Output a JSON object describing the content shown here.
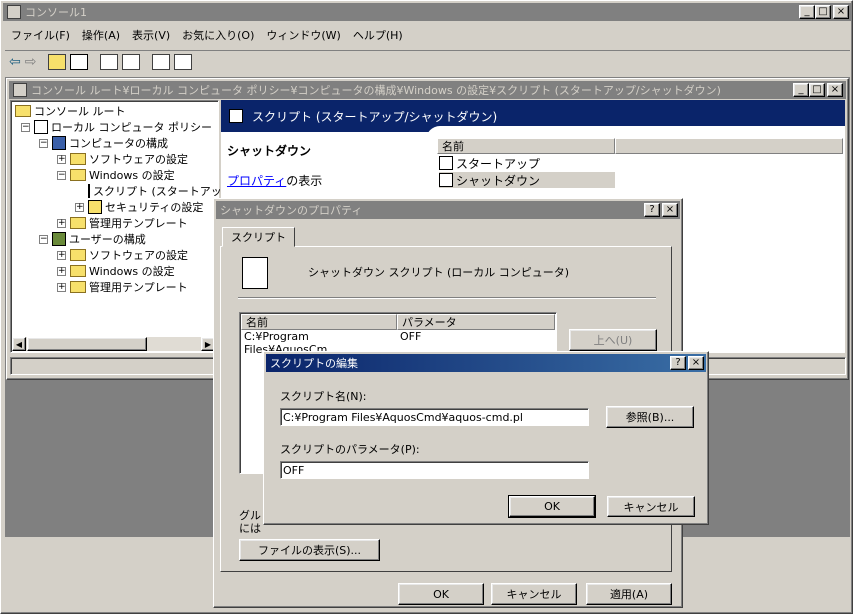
{
  "app": {
    "title": "コンソール1",
    "menu": [
      "ファイル(F)",
      "操作(A)",
      "表示(V)",
      "お気に入り(O)",
      "ウィンドウ(W)",
      "ヘルプ(H)"
    ],
    "buttons": {
      "minimize": "_",
      "maximize": "□",
      "close": "×"
    }
  },
  "child": {
    "title": "コンソール ルート¥ローカル コンピュータ ポリシー¥コンピュータの構成¥Windows の設定¥スクリプト (スタートアップ/シャットダウン)"
  },
  "tree": {
    "items": [
      {
        "label": "コンソール ルート",
        "level": 0
      },
      {
        "label": "ローカル コンピュータ ポリシー",
        "level": 1
      },
      {
        "label": "コンピュータの構成",
        "level": 2
      },
      {
        "label": "ソフトウェアの設定",
        "level": 3
      },
      {
        "label": "Windows の設定",
        "level": 3
      },
      {
        "label": "スクリプト (スタートアップ",
        "level": 4
      },
      {
        "label": "セキュリティの設定",
        "level": 4
      },
      {
        "label": "管理用テンプレート",
        "level": 3
      },
      {
        "label": "ユーザーの構成",
        "level": 2
      },
      {
        "label": "ソフトウェアの設定",
        "level": 3
      },
      {
        "label": "Windows の設定",
        "level": 3
      },
      {
        "label": "管理用テンプレート",
        "level": 3
      }
    ]
  },
  "right_pane": {
    "header": "スクリプト (スタートアップ/シャットダウン)",
    "selected_name": "シャットダウン",
    "properties_link": "プロパティ",
    "properties_suffix": "の表示",
    "list_header": "名前",
    "list_items": [
      "スタートアップ",
      "シャットダウン"
    ]
  },
  "props_dialog": {
    "title": "シャットダウンのプロパティ",
    "tab": "スクリプト",
    "heading": "シャットダウン スクリプト (ローカル コンピュータ)",
    "col_name": "名前",
    "col_param": "パラメータ",
    "row_name": "C:¥Program Files¥AquosCm...",
    "row_param": "OFF",
    "up_button": "上へ(U)",
    "group_text": "グル",
    "group_text2": "には",
    "show_files": "ファイルの表示(S)...",
    "ok": "OK",
    "cancel": "キャンセル",
    "apply": "適用(A)"
  },
  "edit_dialog": {
    "title": "スクリプトの編集",
    "name_label": "スクリプト名(N):",
    "name_value": "C:¥Program Files¥AquosCmd¥aquos-cmd.pl",
    "browse": "参照(B)...",
    "param_label": "スクリプトのパラメータ(P):",
    "param_value": "OFF",
    "ok": "OK",
    "cancel": "キャンセル"
  }
}
